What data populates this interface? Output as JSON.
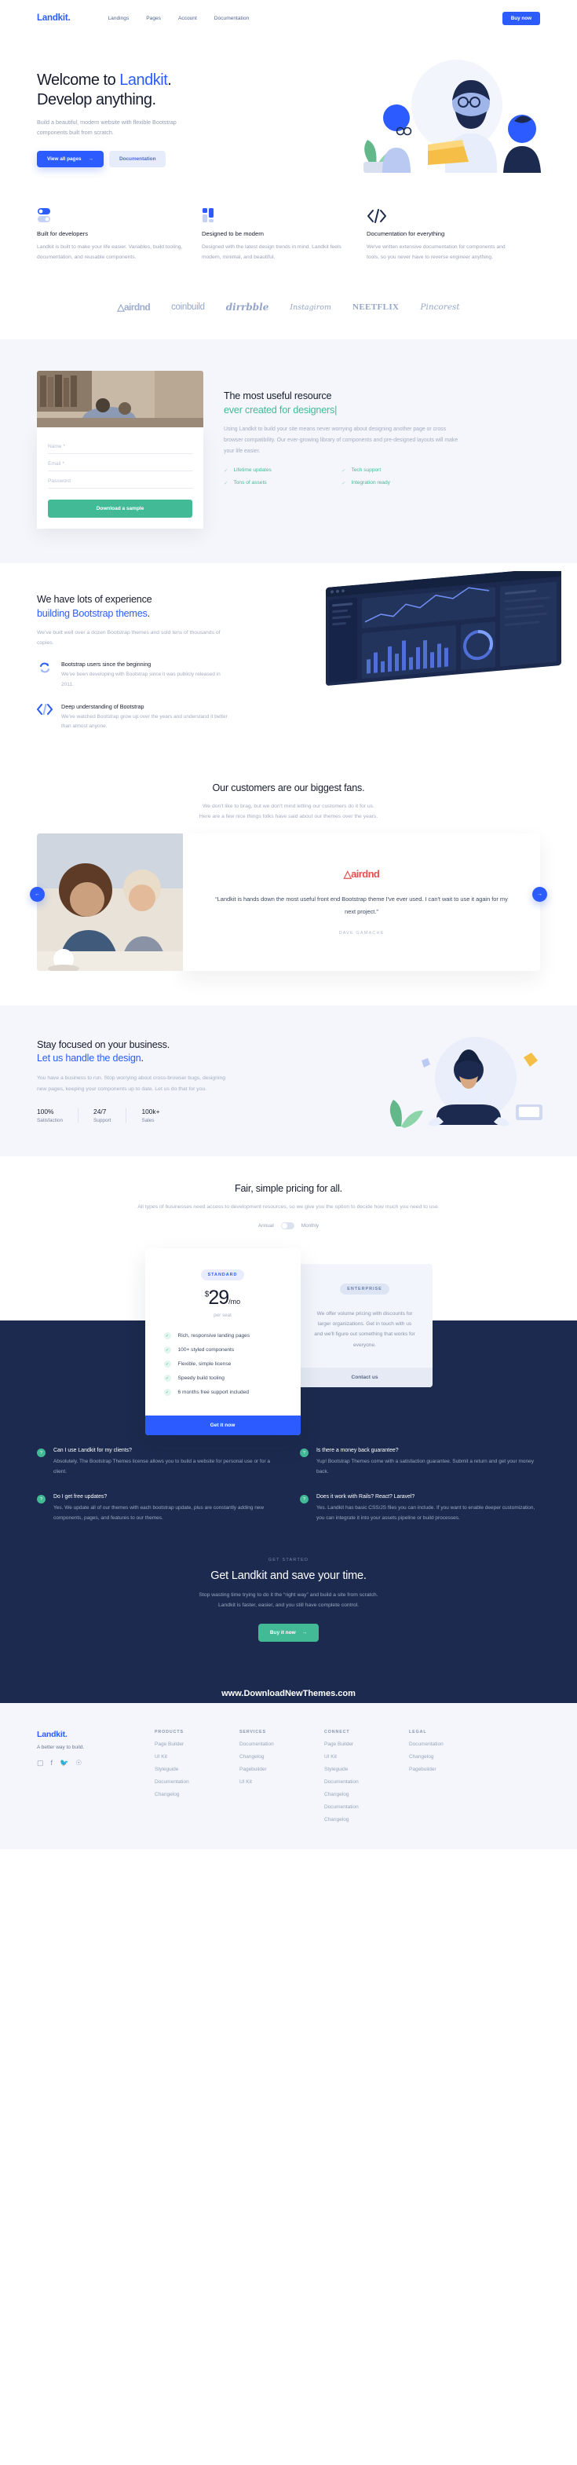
{
  "nav": {
    "logo": "Landkit.",
    "links": [
      "Landings",
      "Pages",
      "Account",
      "Documentation"
    ],
    "cta": "Buy now"
  },
  "hero": {
    "title_plain": "Welcome to ",
    "title_accent": "Landkit",
    "title_dot": ".",
    "title_line2": "Develop anything.",
    "subtitle": "Build a beautiful, modern website with flexible Bootstrap components built from scratch.",
    "primary_btn": "View all pages",
    "primary_btn_icon": "arrow-right-icon",
    "secondary_btn": "Documentation"
  },
  "features": [
    {
      "icon": "toggle-switch-icon",
      "title": "Built for developers",
      "body": "Landkit is built to make your life easier. Variables, build tooling, documentation, and reusable components."
    },
    {
      "icon": "layout-blocks-icon",
      "title": "Designed to be modern",
      "body": "Designed with the latest design trends in mind. Landkit feels modern, minimal, and beautiful."
    },
    {
      "icon": "code-brackets-icon",
      "title": "Documentation for everything",
      "body": "We've written extensive documentation for components and tools, so you never have to reverse engineer anything."
    }
  ],
  "logos": [
    "airdnd",
    "coinbuild",
    "dirrbble",
    "Instagirom",
    "NEETFLIX",
    "Pincorest"
  ],
  "resource": {
    "form": {
      "fields": [
        {
          "label": "Name *"
        },
        {
          "label": "Email *"
        },
        {
          "label": "Password"
        }
      ],
      "submit": "Download a sample"
    },
    "heading_line1": "The most useful resource",
    "heading_line2": "ever created for designers",
    "body": "Using Landkit to build your site means never worrying about designing another page or cross browser compatibility. Our ever-growing library of components and pre-designed layouts will make your life easier.",
    "checks": [
      "Lifetime updates",
      "Tech support",
      "Tons of assets",
      "Integration ready"
    ]
  },
  "experience": {
    "heading_line1": "We have lots of experience",
    "heading_line2": "building Bootstrap themes",
    "heading_dot": ".",
    "body": "We've built well over a dozen Bootstrap themes and sold tens of thousands of copies.",
    "items": [
      {
        "icon": "refresh-cycle-icon",
        "title": "Bootstrap users since the beginning",
        "body": "We've been developing with Bootstrap since it was publicly released in 2011."
      },
      {
        "icon": "code-brackets-icon",
        "title": "Deep understanding of Bootstrap",
        "body": "We've watched Bootstrap grow up over the years and understand it better than almost anyone."
      }
    ]
  },
  "testimonials": {
    "heading": "Our customers are our biggest fans.",
    "subtitle_line1": "We don't like to brag, but we don't mind letting our customers do it for us.",
    "subtitle_line2": "Here are a few nice things folks have said about our themes over the years.",
    "brand": "airdnd",
    "quote": "“Landkit is hands down the most useful front end Bootstrap theme I've ever used. I can't wait to use it again for my next project.”",
    "author": "DAVE GAMACHE",
    "prev_icon": "arrow-left-icon",
    "next_icon": "arrow-right-icon",
    "brand_color": "#e74f4f"
  },
  "focus": {
    "heading_line1": "Stay focused on your business.",
    "heading_line2": "Let us handle the design",
    "heading_dot": ".",
    "body": "You have a business to run. Stop worrying about cross-browser bugs, designing new pages, keeping your components up to date. Let us do that for you.",
    "stats": [
      {
        "num": "100%",
        "label": "Satisfaction"
      },
      {
        "num": "24/7",
        "label": "Support"
      },
      {
        "num": "100k+",
        "label": "Sales"
      }
    ]
  },
  "pricing": {
    "heading": "Fair, simple pricing for all.",
    "subtitle": "All types of businesses need access to development resources, so we give you the option to decide how much you need to use.",
    "toggle_left": "Annual",
    "toggle_right": "Monthly",
    "standard": {
      "badge": "STANDARD",
      "currency": "$",
      "amount": "29",
      "period": "/mo",
      "per_seat": "per seat",
      "features": [
        "Rich, responsive landing pages",
        "100+ styled components",
        "Flexible, simple license",
        "Speedy build tooling",
        "6 months free support included"
      ],
      "cta": "Get it now"
    },
    "enterprise": {
      "badge": "ENTERPRISE",
      "copy": "We offer volume pricing with discounts for larger organizations. Get in touch with us and we'll figure out something that works for everyone.",
      "cta": "Contact us"
    }
  },
  "faq": [
    {
      "q": "Can I use Landkit for my clients?",
      "a": "Absolutely. The Bootstrap Themes license allows you to build a website for personal use or for a client."
    },
    {
      "q": "Is there a money back guarantee?",
      "a": "Yup! Bootstrap Themes come with a satisfaction guarantee. Submit a return and get your money back."
    },
    {
      "q": "Do I get free updates?",
      "a": "Yes. We update all of our themes with each bootstrap update, plus are constantly adding new components, pages, and features to our themes."
    },
    {
      "q": "Does it work with Rails? React? Laravel?",
      "a": "Yes. Landkit has basic CSS/JS files you can include. If you want to enable deeper customization, you can integrate it into your assets pipeline or build processes."
    }
  ],
  "cta": {
    "eyebrow": "GET STARTED",
    "heading": "Get Landkit and save your time.",
    "body_line1": "Stop wasting time trying to do it the “right way” and build a site from scratch.",
    "body_line2": "Landkit is faster, easier, and you still have complete control.",
    "button": "Buy it now",
    "button_icon": "arrow-right-icon",
    "site_name": "www.DownloadNewThemes.com"
  },
  "footer": {
    "logo": "Landkit.",
    "tagline": "A better way to build.",
    "social": [
      "instagram-icon",
      "facebook-icon",
      "twitter-icon",
      "pinterest-icon"
    ],
    "columns": [
      {
        "title": "PRODUCTS",
        "links": [
          "Page Builder",
          "UI Kit",
          "Styleguide",
          "Documentation",
          "Changelog"
        ]
      },
      {
        "title": "SERVICES",
        "links": [
          "Documentation",
          "Changelog",
          "Pagebuilder",
          "UI Kit"
        ]
      },
      {
        "title": "CONNECT",
        "links": [
          "Page Builder",
          "UI Kit",
          "Styleguide",
          "Documentation",
          "Changelog",
          "Documentation",
          "Changelog"
        ]
      },
      {
        "title": "LEGAL",
        "links": [
          "Documentation",
          "Changelog",
          "Pagebuilder"
        ]
      }
    ]
  },
  "colors": {
    "brand_blue": "#2c5cff",
    "dark_navy": "#1b2a4e",
    "green": "#42ba96",
    "muted": "#a4adc2",
    "light_bg": "#f4f6fb"
  }
}
